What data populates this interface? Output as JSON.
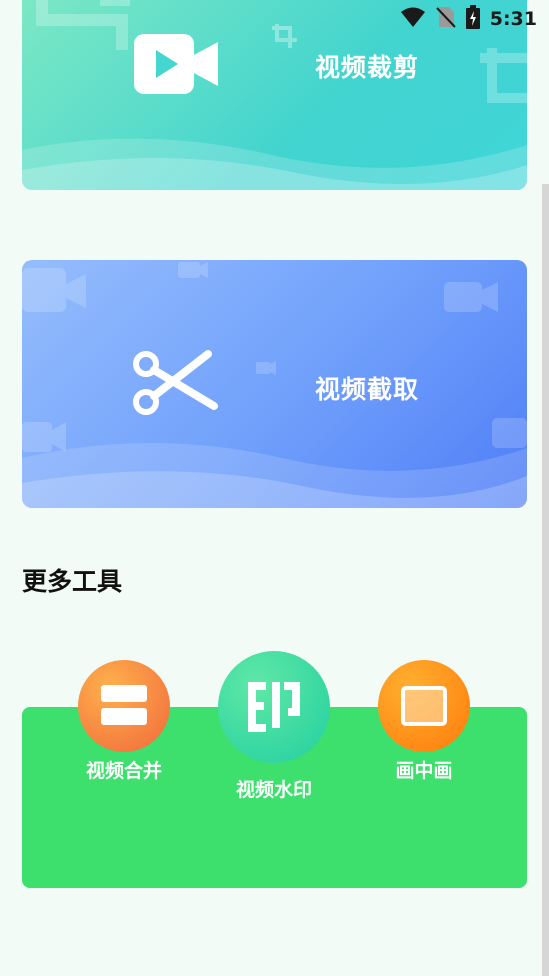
{
  "status_bar": {
    "time": "5:31"
  },
  "cards": {
    "crop": {
      "label": "视频裁剪",
      "icon": "video-camera-icon"
    },
    "cut": {
      "label": "视频截取",
      "icon": "scissors-icon"
    }
  },
  "more_tools": {
    "title": "更多工具",
    "items": [
      {
        "label": "视频合并",
        "icon": "merge-icon",
        "color": "#ff8a3a"
      },
      {
        "label": "视频水印",
        "icon": "watermark-icon",
        "color": "#2fd89c"
      },
      {
        "label": "画中画",
        "icon": "picture-in-picture-icon",
        "color": "#ff8c1a"
      }
    ]
  },
  "colors": {
    "panel": "#3ddf6d",
    "background": "#f2fbf5"
  }
}
